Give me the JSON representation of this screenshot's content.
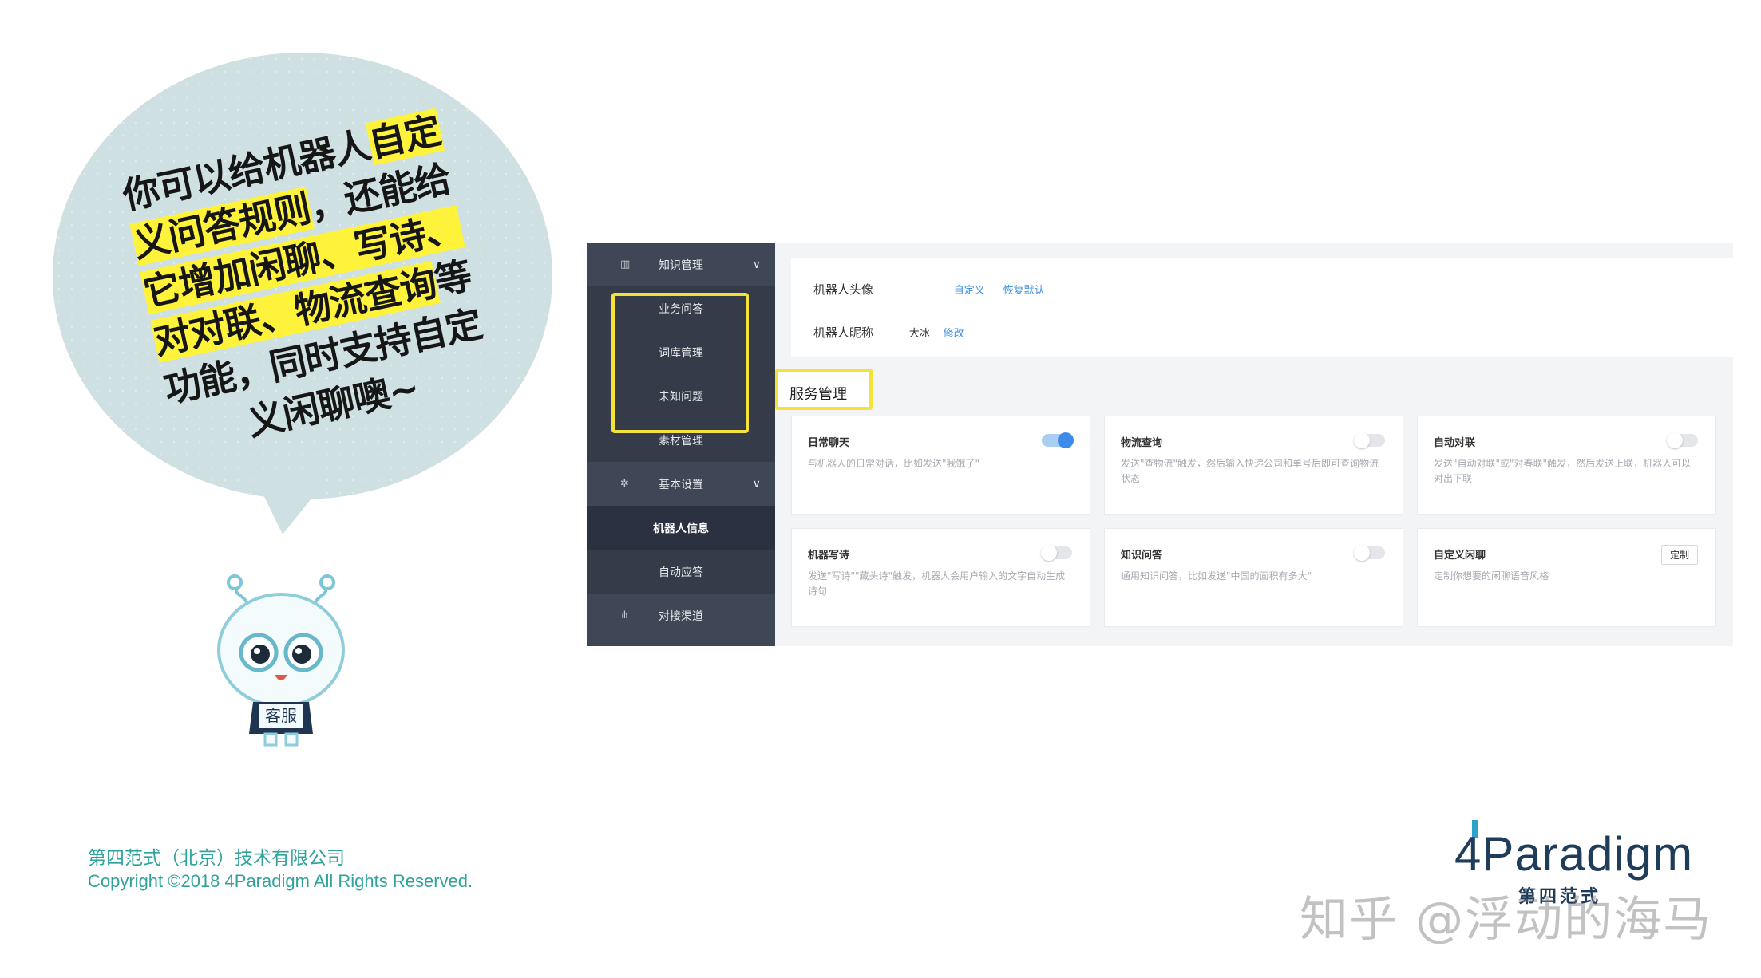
{
  "bubble": {
    "lines": [
      {
        "pre": "你可以给机器人",
        "hl": "自定"
      },
      {
        "pre": "",
        "hl": "义问答规则",
        "post": "，还能给"
      },
      {
        "pre": "",
        "hl": "它增加闲聊、写诗、"
      },
      {
        "pre": "",
        "hl": "对对联、物流查询",
        "post": "等"
      },
      {
        "pre": "功能，同时支持自定"
      },
      {
        "pre": "义闲聊噢~"
      }
    ]
  },
  "mascot": {
    "badge": "客服"
  },
  "sidebar": {
    "knowledge": {
      "label": "知识管理",
      "icon": "book-icon"
    },
    "knowledge_items": [
      "业务问答",
      "词库管理",
      "未知问题",
      "素材管理"
    ],
    "settings": {
      "label": "基本设置",
      "icon": "gear-icon"
    },
    "settings_items": [
      "机器人信息",
      "自动应答"
    ],
    "channel": {
      "label": "对接渠道",
      "icon": "sitemap-icon"
    }
  },
  "info": {
    "avatar_label": "机器人头像",
    "avatar_custom": "自定义",
    "avatar_reset": "恢复默认",
    "nickname_label": "机器人昵称",
    "nickname_value": "大冰",
    "nickname_edit": "修改"
  },
  "services": {
    "title": "服务管理",
    "cards": [
      {
        "title": "日常聊天",
        "desc": "与机器人的日常对话，比如发送\"我饿了\"",
        "control": "toggle",
        "on": true
      },
      {
        "title": "物流查询",
        "desc": "发送\"查物流\"触发，然后输入快递公司和单号后即可查询物流状态",
        "control": "toggle",
        "on": false
      },
      {
        "title": "自动对联",
        "desc": "发送\"自动对联\"或\"对春联\"触发，然后发送上联，机器人可以对出下联",
        "control": "toggle",
        "on": false
      },
      {
        "title": "机器写诗",
        "desc": "发送\"写诗\"\"藏头诗\"触发，机器人会用户输入的文字自动生成诗句",
        "control": "toggle",
        "on": false
      },
      {
        "title": "知识问答",
        "desc": "通用知识问答，比如发送\"中国的面积有多大\"",
        "control": "toggle",
        "on": false
      },
      {
        "title": "自定义闲聊",
        "desc": "定制你想要的闲聊语音风格",
        "control": "button",
        "button_label": "定制"
      }
    ]
  },
  "footer": {
    "company": "第四范式（北京）技术有限公司",
    "copyright": "Copyright ©2018 4Paradigm All Rights Reserved."
  },
  "logo": {
    "word": "4Paradigm",
    "cn": "第四范式"
  },
  "watermark": "知乎 @浮动的海马"
}
